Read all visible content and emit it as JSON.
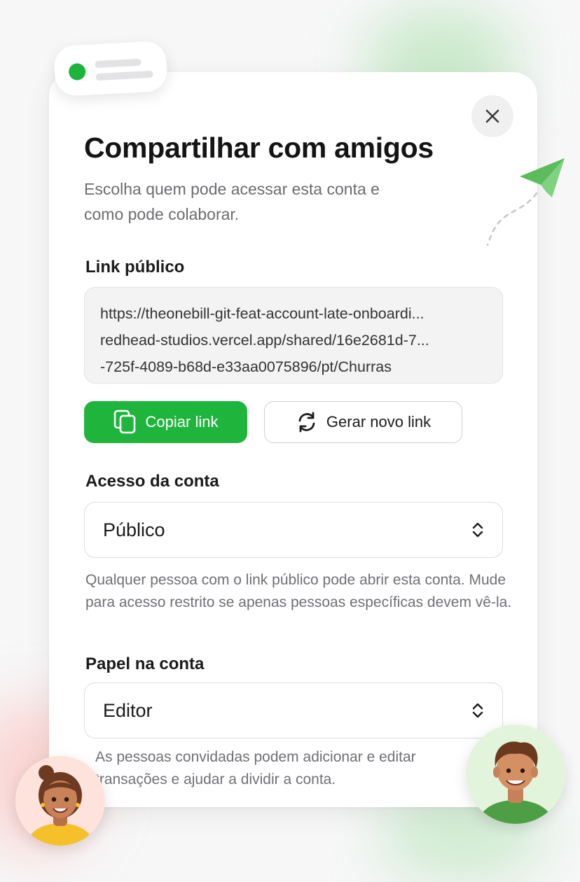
{
  "dialog": {
    "title": "Compartilhar com amigos",
    "subtitle": "Escolha quem pode acessar esta conta e como pode colaborar."
  },
  "public_link": {
    "label": "Link público",
    "lines": [
      "https://theonebill-git-feat-account-late-onboardi...",
      "redhead-studios.vercel.app/shared/16e2681d-7...",
      "-725f-4089-b68d-e33aa0075896/pt/Churras"
    ],
    "copy_label": "Copiar link",
    "regenerate_label": "Gerar novo link"
  },
  "account_access": {
    "label": "Acesso da conta",
    "selected": "Público",
    "helper": "Qualquer pessoa com o link público pode abrir esta conta. Mude para acesso restrito se apenas pessoas específicas devem vê-la."
  },
  "account_role": {
    "label": "Papel na conta",
    "selected": "Editor",
    "helper": "As pessoas convidadas podem adicionar e editar transações e ajudar a dividir a conta."
  },
  "icons": {
    "close": "close-icon",
    "copy": "copy-icon",
    "refresh": "refresh-icon",
    "chevron": "chevron-up-down-icon",
    "plane": "paper-plane-icon"
  },
  "colors": {
    "accent": "#1fb53d",
    "text": "#141414",
    "muted": "#6c6c70"
  }
}
